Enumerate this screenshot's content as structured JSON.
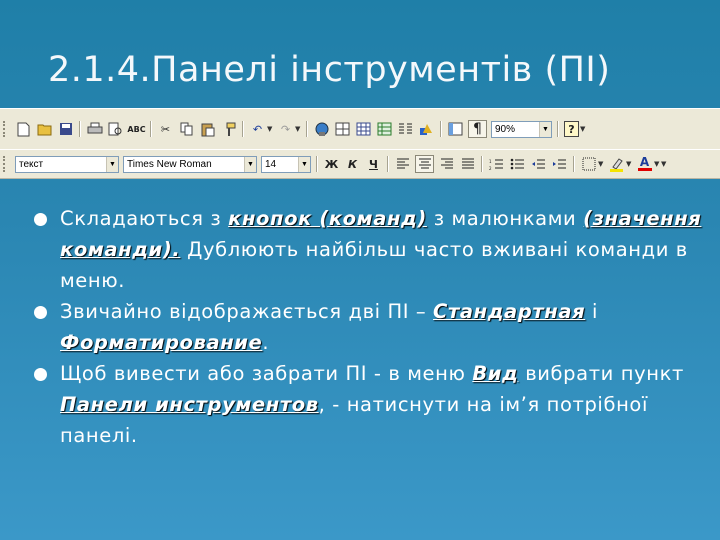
{
  "slide": {
    "title": "2.1.4.Панелі інструментів (ПІ)"
  },
  "standard_toolbar": {
    "zoom": "90%",
    "paragraph_mark": "¶",
    "help": "?"
  },
  "formatting_toolbar": {
    "style": "текст",
    "font": "Times New Roman",
    "size": "14",
    "bold": "Ж",
    "italic": "К",
    "underline": "Ч",
    "font_color_letter": "A"
  },
  "bullets": [
    {
      "t1": "Складаються з ",
      "e1": "кнопок (команд)",
      "t2": " з малюнками ",
      "e2": "(значення команди).",
      "t3": " Дублюють найбільш часто вживані команди в меню."
    },
    {
      "t1": "Звичайно відображається дві ПІ – ",
      "e1": "Стандартная",
      "t2": " і ",
      "e2": "Форматирование",
      "t3": "."
    },
    {
      "t1": "Щоб вивести або забрати ПІ -  в меню ",
      "e1": "Вид",
      "t2": " вибрати пункт ",
      "e2": "Панели инструментов",
      "t3": ", - натиснути на ім’я потрібної панелі."
    }
  ],
  "colors": {
    "background_top": "#1f7fa8",
    "background_bottom": "#3b98c8",
    "toolbar": "#ece9d8"
  }
}
